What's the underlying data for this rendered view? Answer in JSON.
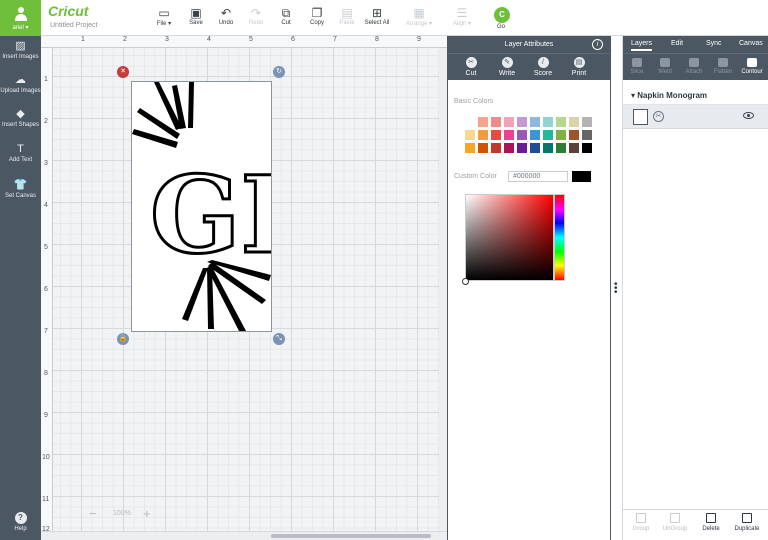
{
  "user": {
    "name": "ariel ▾"
  },
  "brand": "Cricut",
  "project_title": "Untitled Project",
  "toolbar": {
    "file": "File ▾",
    "save": "Save",
    "undo": "Undo",
    "redo": "Redo",
    "cut": "Cut",
    "copy": "Copy",
    "paste": "Paste",
    "select_all": "Select All",
    "arrange": "Arrange ▾",
    "align": "Align ▾",
    "go": "Go",
    "go_icon": "C"
  },
  "left_tools": {
    "insert_images": "Insert Images",
    "upload_images": "Upload Images",
    "insert_shapes": "Insert Shapes",
    "add_text": "Add Text",
    "set_canvas": "Set Canvas",
    "help": "Help"
  },
  "canvas": {
    "ruler_top": [
      "1",
      "2",
      "3",
      "4",
      "5",
      "6",
      "7",
      "8",
      "9"
    ],
    "ruler_left": [
      "1",
      "2",
      "3",
      "4",
      "5",
      "6",
      "7",
      "8",
      "9",
      "10",
      "11",
      "12"
    ],
    "monogram": "GH",
    "zoom": "100%"
  },
  "layer_attributes": {
    "title": "Layer Attributes",
    "tabs": [
      "Cut",
      "Write",
      "Score",
      "Print"
    ],
    "basic_colors_label": "Basic Colors",
    "custom_color_label": "Custom Color",
    "hex_placeholder": "#000000",
    "current_color": "#000000",
    "swatches": [
      "#ffffff",
      "#f4a48a",
      "#f28c8c",
      "#f2a3b8",
      "#c39bd3",
      "#8fb8e0",
      "#8fd3d3",
      "#b5d88e",
      "#d8d3a8",
      "#b3b3b3",
      "#f6d98e",
      "#f39c3a",
      "#e74c3c",
      "#e84393",
      "#9b59b6",
      "#3498db",
      "#1abc9c",
      "#7cb342",
      "#a0522d",
      "#666666",
      "#f5a623",
      "#d35400",
      "#c0392b",
      "#ad1457",
      "#6a1b9a",
      "#1f4e96",
      "#00796b",
      "#2e7d32",
      "#5d4037",
      "#000000"
    ]
  },
  "layers_panel": {
    "tabs": [
      "Layers",
      "Edit",
      "Sync",
      "Canvas"
    ],
    "tools": [
      "Slice",
      "Weld",
      "Attach",
      "Flatten",
      "Contour"
    ],
    "group_name": "Napkin Monogram",
    "bottom": [
      "Group",
      "UnGroup",
      "Delete",
      "Duplicate"
    ]
  }
}
